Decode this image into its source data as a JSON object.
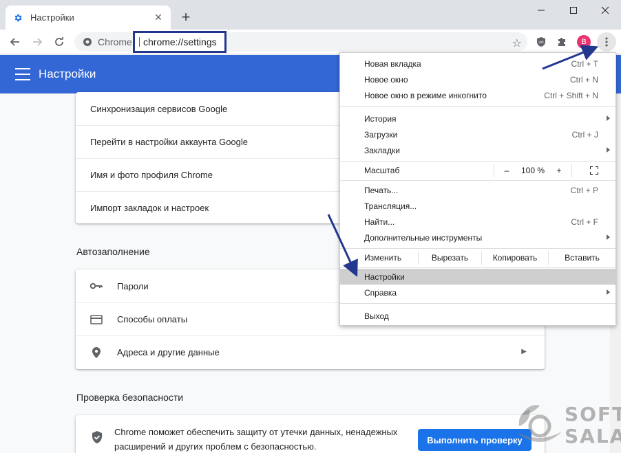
{
  "tab": {
    "title": "Настройки"
  },
  "toolbar": {
    "origin": "Chrome",
    "url": "chrome://settings",
    "avatar_letter": "B"
  },
  "settings": {
    "title": "Настройки"
  },
  "account_rows": [
    "Синхронизация сервисов Google",
    "Перейти в настройки аккаунта Google",
    "Имя и фото профиля Chrome",
    "Импорт закладок и настроек"
  ],
  "autofill": {
    "title": "Автозаполнение",
    "rows": [
      "Пароли",
      "Способы оплаты",
      "Адреса и другие данные"
    ]
  },
  "safety": {
    "title": "Проверка безопасности",
    "text": "Chrome поможет обеспечить защиту от утечки данных, ненадежных расширений и других проблем с безопасностью.",
    "button": "Выполнить проверку"
  },
  "menu": {
    "new_tab": "Новая вкладка",
    "new_tab_sc": "Ctrl + T",
    "new_window": "Новое окно",
    "new_window_sc": "Ctrl + N",
    "incognito": "Новое окно в режиме инкогнито",
    "incognito_sc": "Ctrl + Shift + N",
    "history": "История",
    "downloads": "Загрузки",
    "downloads_sc": "Ctrl + J",
    "bookmarks": "Закладки",
    "zoom": "Масштаб",
    "zoom_minus": "–",
    "zoom_value": "100 %",
    "zoom_plus": "+",
    "print": "Печать...",
    "print_sc": "Ctrl + P",
    "cast": "Трансляция...",
    "find": "Найти...",
    "find_sc": "Ctrl + F",
    "more_tools": "Дополнительные инструменты",
    "edit": "Изменить",
    "cut": "Вырезать",
    "copy": "Копировать",
    "paste": "Вставить",
    "settings": "Настройки",
    "help": "Справка",
    "exit": "Выход"
  },
  "watermark": {
    "line1": "SOFT",
    "line2": "SALAD"
  },
  "colors": {
    "header_blue": "#3367d6",
    "annotation": "#23378f",
    "button_blue": "#1a73e8"
  }
}
